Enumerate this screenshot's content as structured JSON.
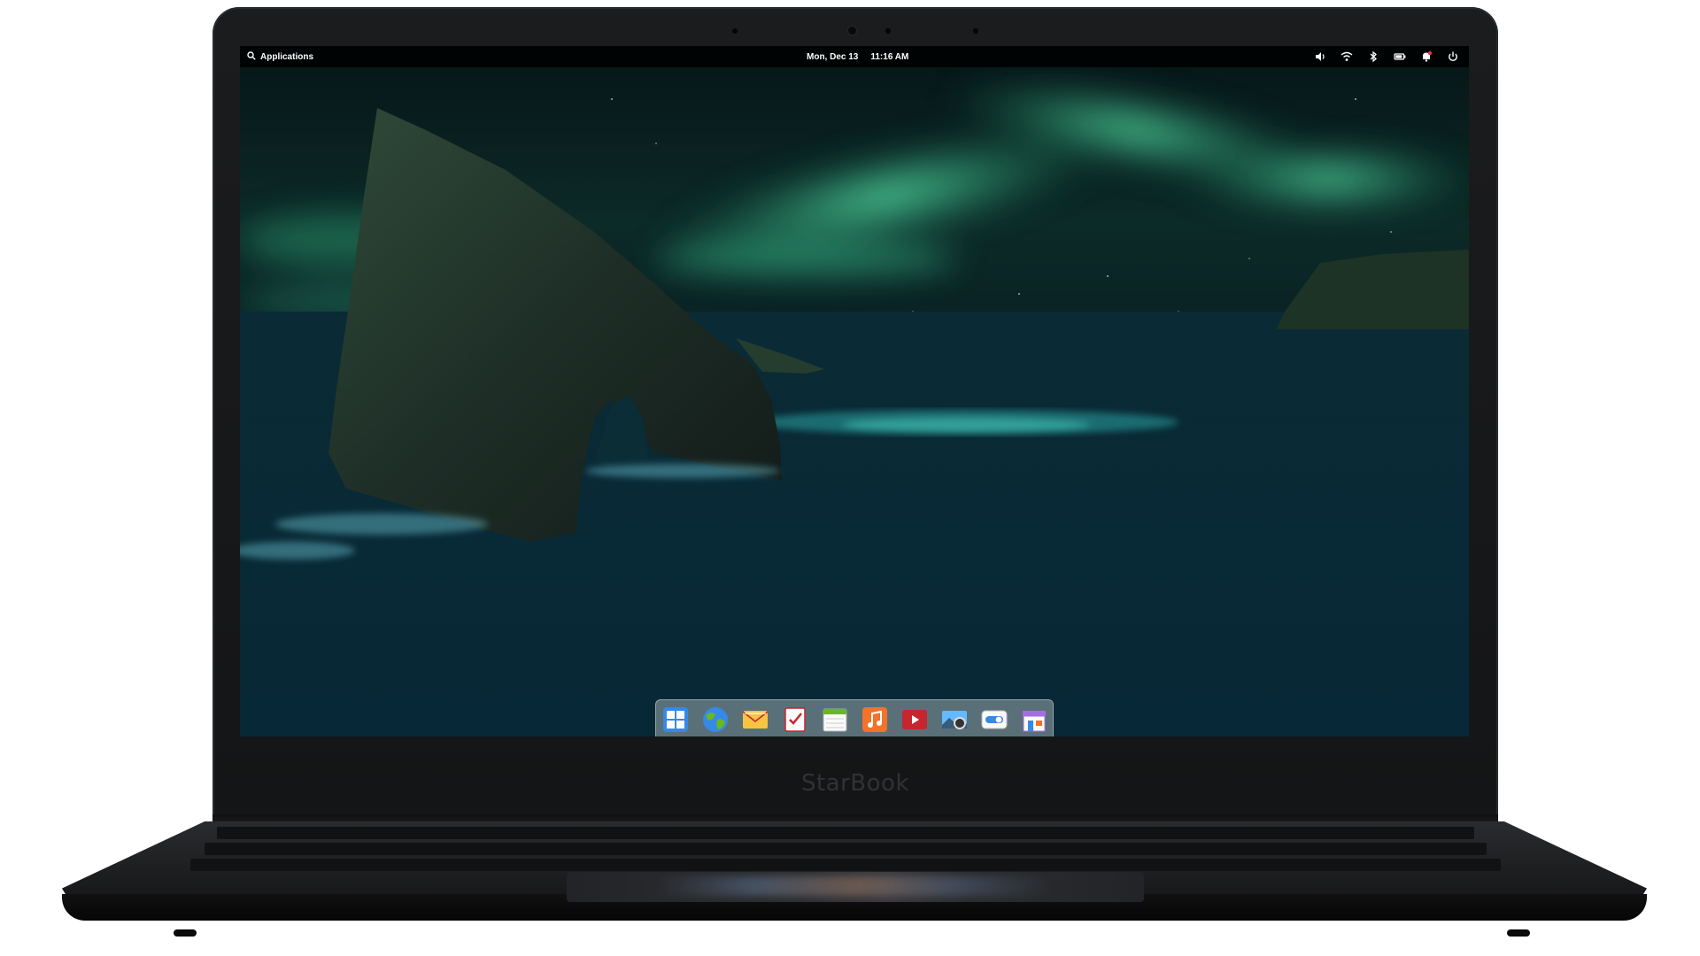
{
  "device": {
    "brand_label": "StarBook"
  },
  "panel": {
    "applications_label": "Applications",
    "date": "Mon, Dec 13",
    "time": "11:16 AM",
    "indicators": [
      "volume-icon",
      "wifi-icon",
      "bluetooth-icon",
      "battery-icon",
      "notifications-icon",
      "power-icon"
    ]
  },
  "dock": {
    "apps": [
      {
        "name": "multitasking-view-icon"
      },
      {
        "name": "web-browser-icon"
      },
      {
        "name": "mail-icon"
      },
      {
        "name": "tasks-icon"
      },
      {
        "name": "calendar-icon"
      },
      {
        "name": "music-icon"
      },
      {
        "name": "videos-icon"
      },
      {
        "name": "photos-icon"
      },
      {
        "name": "system-settings-icon"
      },
      {
        "name": "app-center-icon"
      }
    ]
  },
  "colors": {
    "panel_bg": "#000000",
    "aurora": "#3de0a0",
    "sea": "#0b3a48",
    "laptop_body": "#1b1c1e"
  }
}
